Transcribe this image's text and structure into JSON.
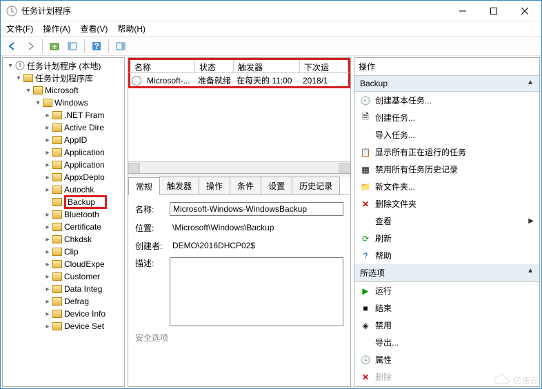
{
  "window": {
    "title": "任务计划程序"
  },
  "menu": {
    "file": "文件(F)",
    "operation": "操作(A)",
    "view": "查看(V)",
    "help": "帮助(H)"
  },
  "tree": {
    "root": "任务计划程序 (本地)",
    "library": "任务计划程序库",
    "microsoft": "Microsoft",
    "windows": "Windows",
    "items": [
      ".NET Fram",
      "Active Dire",
      "AppID",
      "Application",
      "Application",
      "AppxDeplo",
      "Autochk"
    ],
    "selected": "Backup",
    "items2": [
      "Bluetooth",
      "Certificate",
      "Chkdsk",
      "Clip",
      "CloudExpe",
      "Customer",
      "Data Integ",
      "Defrag",
      "Device Info",
      "Device Set"
    ]
  },
  "task_list": {
    "headers": {
      "name": "名称",
      "state": "状态",
      "trigger": "触发器",
      "next": "下次运"
    },
    "row": {
      "name": "Microsoft-...",
      "state": "准备就绪",
      "trigger": "在每天的 11:00",
      "next": "2018/1"
    }
  },
  "detail": {
    "tabs": {
      "general": "常规",
      "triggers": "触发器",
      "actions": "操作",
      "conditions": "条件",
      "settings": "设置",
      "history": "历史记录"
    },
    "labels": {
      "name": "名称:",
      "location": "位置:",
      "creator": "创建者:",
      "desc": "描述:"
    },
    "values": {
      "name": "Microsoft-Windows-WindowsBackup",
      "location": "\\Microsoft\\Windows\\Backup",
      "creator": "DEMO\\2016DHCP02$"
    },
    "security_header": "安全选项"
  },
  "actions": {
    "header": "操作",
    "section_backup": "Backup",
    "section_selected": "所选项",
    "items": {
      "create_basic": "创建基本任务...",
      "create": "创建任务...",
      "import": "导入任务...",
      "show_running": "显示所有正在运行的任务",
      "disable_history": "禁用所有任务历史记录",
      "new_folder": "新文件夹...",
      "delete_folder": "删除文件夹",
      "view": "查看",
      "refresh": "刷新",
      "help": "帮助",
      "run": "运行",
      "end": "结束",
      "disable": "禁用",
      "export": "导出...",
      "properties": "属性",
      "delete": "删除"
    }
  },
  "watermark": "亿速云"
}
